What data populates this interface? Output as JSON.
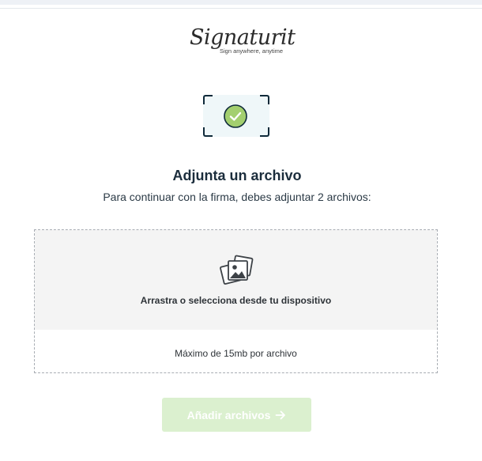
{
  "logo": {
    "wordmark": "Signaturit",
    "tagline": "Sign anywhere, anytime"
  },
  "header": {
    "title": "Adjunta un archivo",
    "subtitle": "Para continuar con la firma, debes adjuntar 2 archivos:"
  },
  "dropzone": {
    "icon": "photos-icon",
    "instruction": "Arrastra o selecciona desde tu dispositivo",
    "limit": "Máximo de 15mb por archivo"
  },
  "actions": {
    "add_label": "Añadir archivos",
    "add_enabled": false
  },
  "colors": {
    "success_green": "#a3cf6f",
    "button_disabled": "#dbf0cf",
    "frame_dark": "#0f2a3a"
  }
}
